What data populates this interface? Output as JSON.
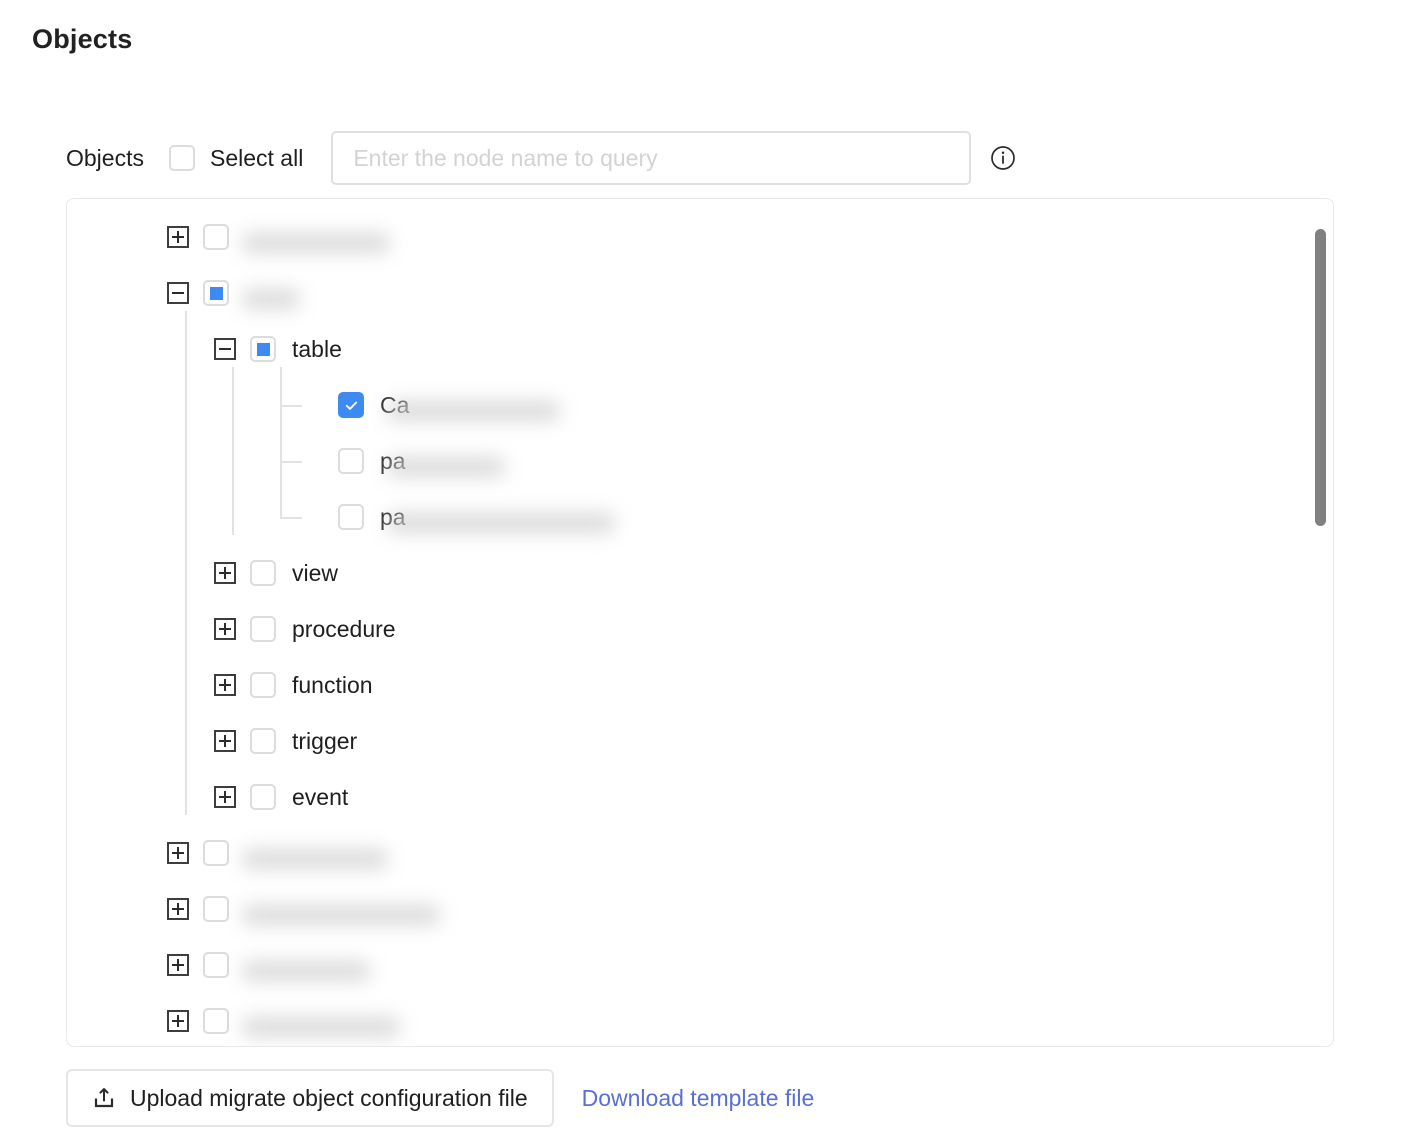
{
  "page": {
    "title": "Objects"
  },
  "header": {
    "label": "Objects",
    "select_all_label": "Select all",
    "select_all_checked": false,
    "info_icon": "info-circle-icon"
  },
  "search": {
    "value": "",
    "placeholder": "Enter the node name to query"
  },
  "colors": {
    "accent_blue": "#3d8bf2",
    "link_blue": "#5a6fd4",
    "border_grey": "#e0e0e0",
    "placeholder_grey": "#d3d3d3",
    "scrollbar_grey": "#808080",
    "text_dark": "#1f1f1f"
  },
  "tree": {
    "nodes": [
      {
        "id": "n0",
        "level": 0,
        "toggle": "plus",
        "check_state": "unchecked",
        "label": "",
        "redacted": true,
        "visible_prefix": "",
        "blur_width": 150
      },
      {
        "id": "n1",
        "level": 0,
        "toggle": "minus",
        "check_state": "indeterminate",
        "label": "",
        "redacted": true,
        "visible_prefix": "",
        "blur_width": 60
      },
      {
        "id": "n1-table",
        "level": 1,
        "toggle": "minus",
        "check_state": "indeterminate",
        "label": "table",
        "redacted": false,
        "visible_prefix": "table",
        "blur_width": 0
      },
      {
        "id": "n1-table-c1",
        "level": 2,
        "toggle": "none",
        "check_state": "checked",
        "label": "Ca",
        "redacted": true,
        "visible_prefix": "Ca",
        "blur_width": 175
      },
      {
        "id": "n1-table-c2",
        "level": 2,
        "toggle": "none",
        "check_state": "unchecked",
        "label": "pa",
        "redacted": true,
        "visible_prefix": "pa",
        "blur_width": 120
      },
      {
        "id": "n1-table-c3",
        "level": 2,
        "toggle": "none",
        "check_state": "unchecked",
        "label": "pa",
        "redacted": true,
        "visible_prefix": "pa",
        "blur_width": 230
      },
      {
        "id": "n1-view",
        "level": 1,
        "toggle": "plus",
        "check_state": "unchecked",
        "label": "view",
        "redacted": false,
        "visible_prefix": "view",
        "blur_width": 0
      },
      {
        "id": "n1-procedure",
        "level": 1,
        "toggle": "plus",
        "check_state": "unchecked",
        "label": "procedure",
        "redacted": false,
        "visible_prefix": "procedure",
        "blur_width": 0
      },
      {
        "id": "n1-function",
        "level": 1,
        "toggle": "plus",
        "check_state": "unchecked",
        "label": "function",
        "redacted": false,
        "visible_prefix": "function",
        "blur_width": 0
      },
      {
        "id": "n1-trigger",
        "level": 1,
        "toggle": "plus",
        "check_state": "unchecked",
        "label": "trigger",
        "redacted": false,
        "visible_prefix": "trigger",
        "blur_width": 0
      },
      {
        "id": "n1-event",
        "level": 1,
        "toggle": "plus",
        "check_state": "unchecked",
        "label": "event",
        "redacted": false,
        "visible_prefix": "event",
        "blur_width": 0
      },
      {
        "id": "n2",
        "level": 0,
        "toggle": "plus",
        "check_state": "unchecked",
        "label": "",
        "redacted": true,
        "visible_prefix": "",
        "blur_width": 148
      },
      {
        "id": "n3",
        "level": 0,
        "toggle": "plus",
        "check_state": "unchecked",
        "label": "",
        "redacted": true,
        "visible_prefix": "",
        "blur_width": 200
      },
      {
        "id": "n4",
        "level": 0,
        "toggle": "plus",
        "check_state": "unchecked",
        "label": "",
        "redacted": true,
        "visible_prefix": "",
        "blur_width": 130
      },
      {
        "id": "n5",
        "level": 0,
        "toggle": "plus",
        "check_state": "unchecked",
        "label": "",
        "redacted": true,
        "visible_prefix": "",
        "blur_width": 160
      }
    ]
  },
  "footer": {
    "upload_label": "Upload migrate object configuration file",
    "upload_icon": "upload-icon",
    "download_label": "Download template file"
  }
}
